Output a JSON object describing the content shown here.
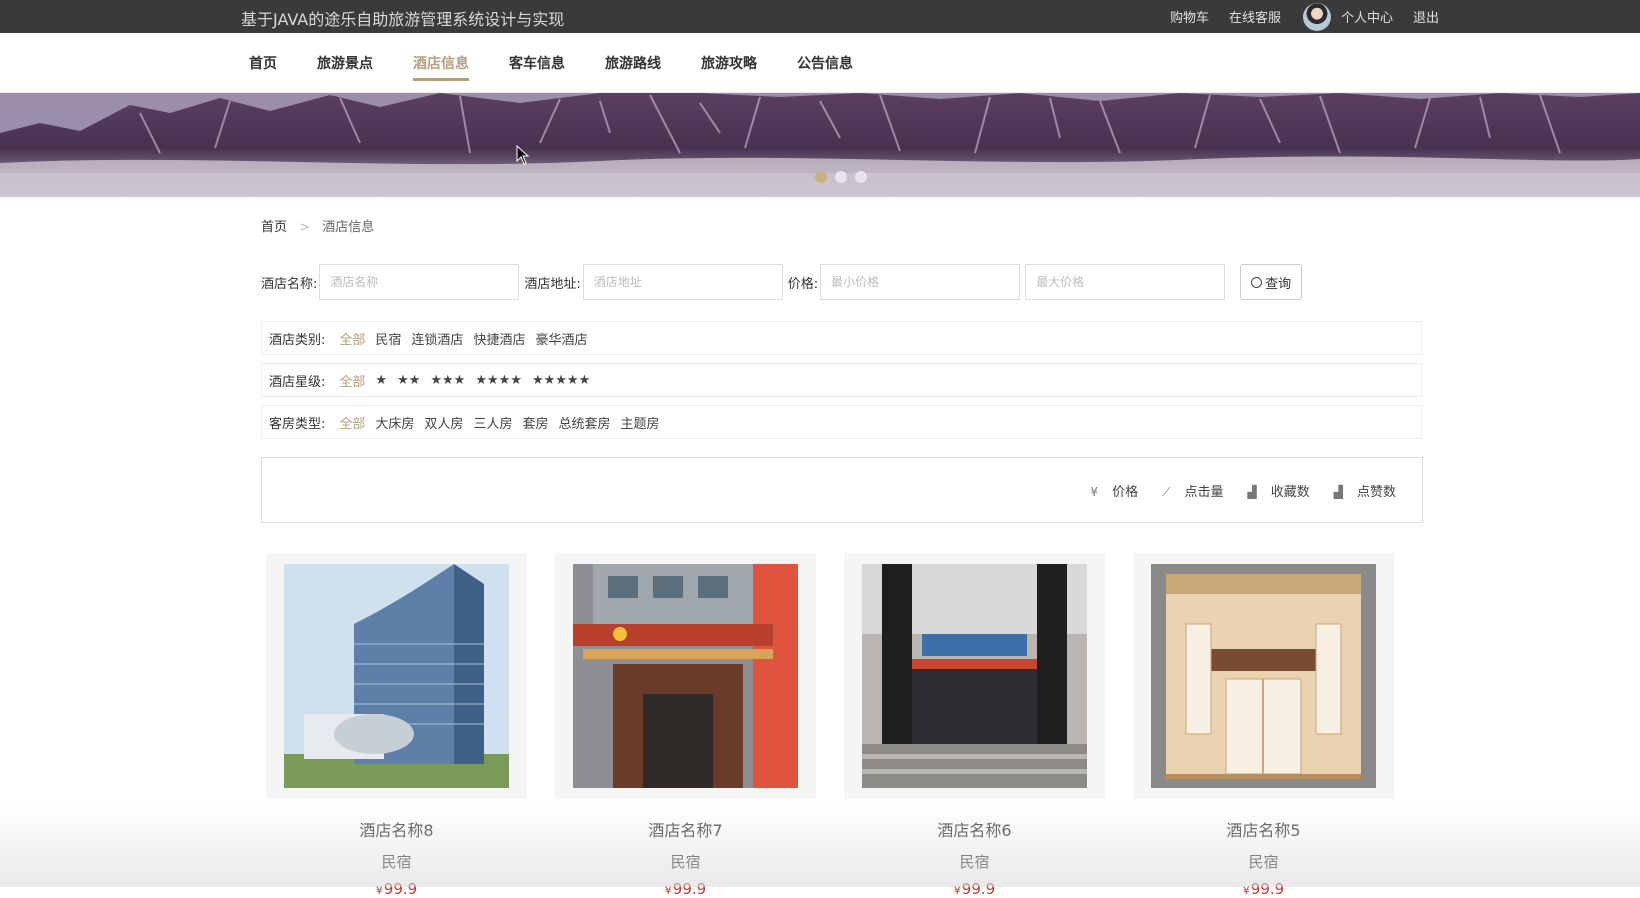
{
  "header": {
    "site_title": "基于JAVA的途乐自助旅游管理系统设计与实现",
    "links": {
      "cart": "购物车",
      "online_service": "在线客服",
      "profile": "个人中心",
      "logout": "退出"
    }
  },
  "nav": {
    "items": [
      {
        "label": "首页"
      },
      {
        "label": "旅游景点"
      },
      {
        "label": "酒店信息",
        "active": true
      },
      {
        "label": "客车信息"
      },
      {
        "label": "旅游路线"
      },
      {
        "label": "旅游攻略"
      },
      {
        "label": "公告信息"
      }
    ]
  },
  "banner": {
    "slides": 3,
    "active_slide": 1
  },
  "breadcrumb": {
    "home": "首页",
    "separator": ">",
    "current": "酒店信息"
  },
  "search": {
    "name_label": "酒店名称:",
    "name_placeholder": "酒店名称",
    "address_label": "酒店地址:",
    "address_placeholder": "酒店地址",
    "price_label": "价格:",
    "min_placeholder": "最小价格",
    "max_placeholder": "最大价格",
    "button_label": "查询",
    "button_icon": "search-icon"
  },
  "filters": {
    "category": {
      "label": "酒店类别:",
      "options": [
        "全部",
        "民宿",
        "连锁酒店",
        "快捷酒店",
        "豪华酒店"
      ]
    },
    "stars": {
      "label": "酒店星级:",
      "options": [
        "全部",
        "★",
        "★★",
        "★★★",
        "★★★★",
        "★★★★★"
      ]
    },
    "room": {
      "label": "客房类型:",
      "options": [
        "全部",
        "大床房",
        "双人房",
        "三人房",
        "套房",
        "总统套房",
        "主题房"
      ]
    },
    "active_color": "#b1a07f"
  },
  "sort": {
    "price": {
      "icon": "¥",
      "label": "价格"
    },
    "clicks": {
      "icon": "trend-icon",
      "label": "点击量"
    },
    "favorites": {
      "icon": "bar-chart-icon",
      "label": "收藏数"
    },
    "likes": {
      "icon": "bar-chart-icon",
      "label": "点赞数"
    }
  },
  "hotels": [
    {
      "name": "酒店名称8",
      "type": "民宿",
      "currency": "¥",
      "price": "99.9"
    },
    {
      "name": "酒店名称7",
      "type": "民宿",
      "currency": "¥",
      "price": "99.9"
    },
    {
      "name": "酒店名称6",
      "type": "民宿",
      "currency": "¥",
      "price": "99.9"
    },
    {
      "name": "酒店名称5",
      "type": "民宿",
      "currency": "¥",
      "price": "99.9"
    }
  ],
  "colors": {
    "topbar": "#3a3a3a",
    "accent": "#b1a07f",
    "price": "#c0392b"
  }
}
